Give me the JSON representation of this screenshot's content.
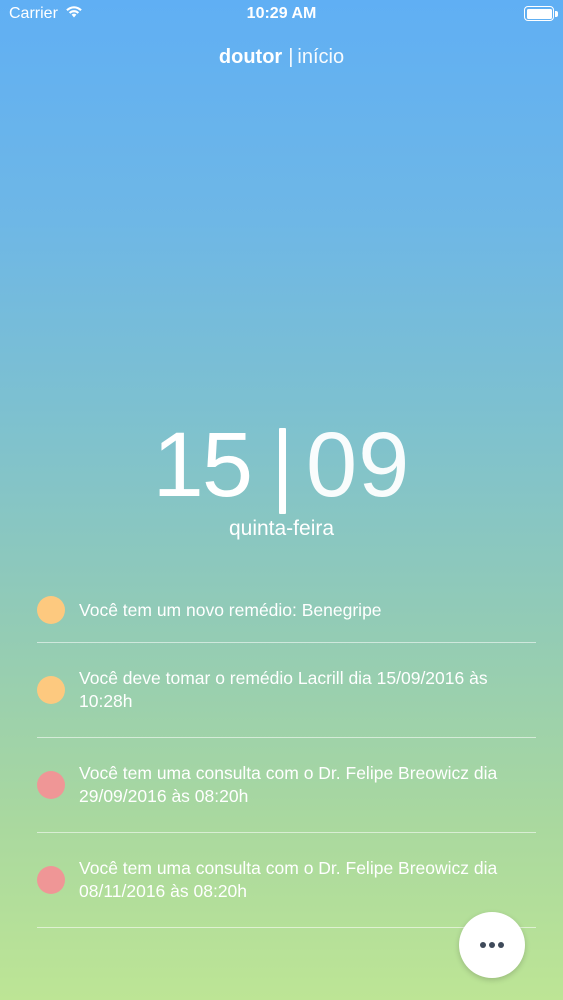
{
  "status_bar": {
    "carrier": "Carrier",
    "time": "10:29 AM",
    "icons": [
      "wifi-icon",
      "battery-icon"
    ]
  },
  "header": {
    "brand": "doutor",
    "separator": "|",
    "section": "início"
  },
  "date": {
    "day": "15",
    "divider": "|",
    "month": "09",
    "weekday": "quinta-feira"
  },
  "notifications": [
    {
      "text": "Você tem um novo remédio: Benegripe",
      "dot_color": "#fdc97f",
      "kind": "remedio"
    },
    {
      "text": "Você deve tomar o remédio Lacrill dia 15/09/2016 às 10:28h",
      "dot_color": "#fdc97f",
      "kind": "remedio"
    },
    {
      "text": "Você tem uma consulta com o Dr. Felipe Breowicz dia 29/09/2016 às 08:20h",
      "dot_color": "#ef9696",
      "kind": "consulta"
    },
    {
      "text": "Você tem uma consulta com o Dr. Felipe Breowicz dia 08/11/2016 às 08:20h",
      "dot_color": "#ef9696",
      "kind": "consulta"
    }
  ],
  "fab": {
    "icon": "more-horizontal-icon"
  }
}
